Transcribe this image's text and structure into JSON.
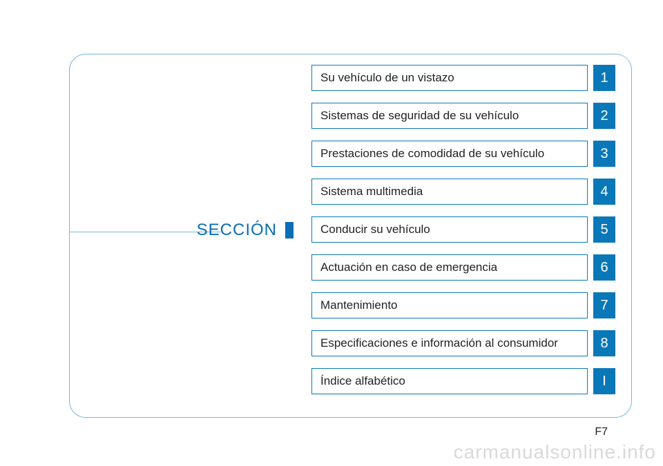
{
  "section_heading": "SECCIÓN",
  "toc": [
    {
      "label": "Su vehículo de un vistazo",
      "number": "1"
    },
    {
      "label": "Sistemas de seguridad de su vehículo",
      "number": "2"
    },
    {
      "label": "Prestaciones de comodidad de su vehículo",
      "number": "3"
    },
    {
      "label": "Sistema multimedia",
      "number": "4"
    },
    {
      "label": "Conducir su vehículo",
      "number": "5"
    },
    {
      "label": "Actuación en caso de emergencia",
      "number": "6"
    },
    {
      "label": "Mantenimiento",
      "number": "7"
    },
    {
      "label": "Especificaciones e información al consumidor",
      "number": "8"
    },
    {
      "label": "Índice alfabético",
      "number": "I"
    }
  ],
  "page_number": "F7",
  "watermark": "carmanualsonline.info"
}
